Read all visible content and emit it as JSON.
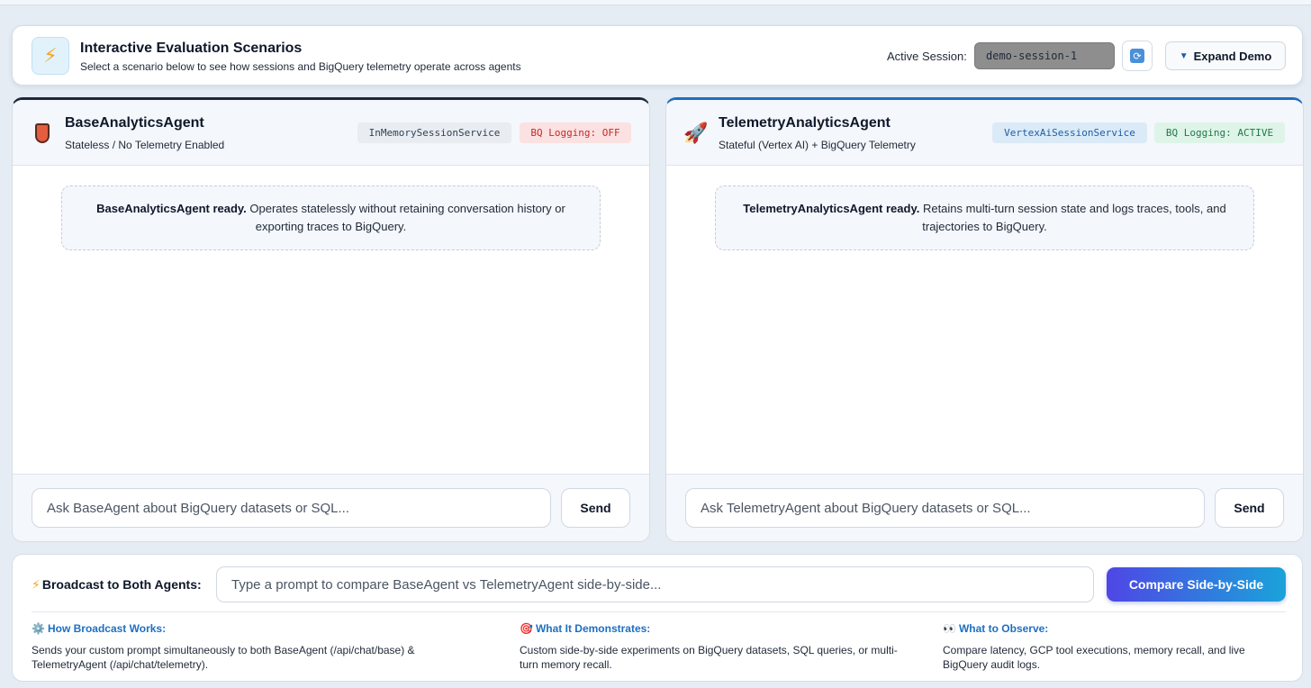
{
  "header": {
    "title": "Interactive Evaluation Scenarios",
    "subtitle": "Select a scenario below to see how sessions and BigQuery telemetry operate across agents",
    "icon": "lightning-icon",
    "session_label": "Active Session:",
    "session_value": "demo-session-1",
    "expand_label": "Expand Demo"
  },
  "agents": {
    "base": {
      "name": "BaseAnalyticsAgent",
      "subtitle": "Stateless / No Telemetry Enabled",
      "icon": "shield-icon",
      "badge_service": "InMemorySessionService",
      "badge_logging": "BQ Logging: OFF",
      "ready_title": "BaseAnalyticsAgent ready.",
      "ready_text": " Operates statelessly without retaining conversation history or exporting traces to BigQuery.",
      "input_placeholder": "Ask BaseAgent about BigQuery datasets or SQL...",
      "send_label": "Send"
    },
    "telemetry": {
      "name": "TelemetryAnalyticsAgent",
      "subtitle": "Stateful (Vertex AI) + BigQuery Telemetry",
      "icon": "rocket-icon",
      "badge_service": "VertexAiSessionService",
      "badge_logging": "BQ Logging: ACTIVE",
      "ready_title": "TelemetryAnalyticsAgent ready.",
      "ready_text": " Retains multi-turn session state and logs traces, tools, and trajectories to BigQuery.",
      "input_placeholder": "Ask TelemetryAgent about BigQuery datasets or SQL...",
      "send_label": "Send"
    }
  },
  "broadcast": {
    "label": "Broadcast to Both Agents:",
    "input_placeholder": "Type a prompt to compare BaseAgent vs TelemetryAgent side-by-side...",
    "compare_label": "Compare Side-by-Side",
    "info": [
      {
        "icon": "gear-icon",
        "title": "How Broadcast Works:",
        "text": "Sends your custom prompt simultaneously to both BaseAgent (/api/chat/base) & TelemetryAgent (/api/chat/telemetry)."
      },
      {
        "icon": "target-icon",
        "title": "What It Demonstrates:",
        "text": "Custom side-by-side experiments on BigQuery datasets, SQL queries, or multi-turn memory recall."
      },
      {
        "icon": "eyes-icon",
        "title": "What to Observe:",
        "text": "Compare latency, GCP tool executions, memory recall, and live BigQuery audit logs."
      }
    ]
  },
  "colors": {
    "accent_blue": "#1d6fc2",
    "logging_off": "#c62828",
    "logging_active": "#1e7a45",
    "compare_gradient_start": "#4f46e5",
    "compare_gradient_end": "#1aa3d9"
  }
}
